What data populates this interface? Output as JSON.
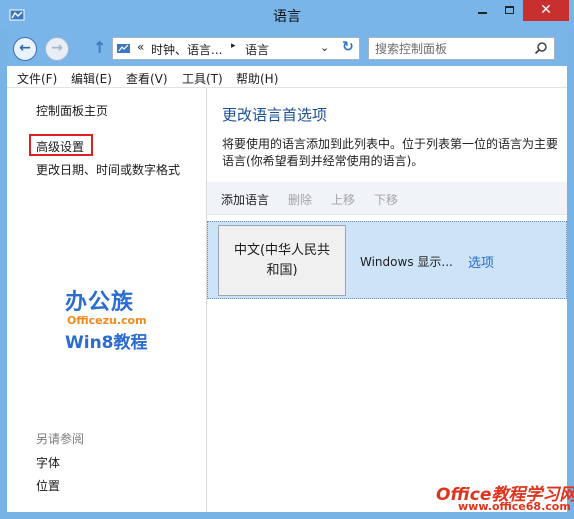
{
  "window": {
    "title": "语言",
    "minimize_icon": "minimize-icon",
    "maximize_icon": "maximize-icon",
    "close_glyph": "✕"
  },
  "nav": {
    "back_glyph": "←",
    "forward_glyph": "→",
    "up_glyph": "↑",
    "breadcrumb_prefix": "«",
    "crumbs": [
      "时钟、语言...",
      "语言"
    ],
    "crumb_separator": "▸",
    "dropdown_glyph": "⌄",
    "refresh_glyph": "↻",
    "search_placeholder": "搜索控制面板"
  },
  "menu": {
    "items": [
      "文件(F)",
      "编辑(E)",
      "查看(V)",
      "工具(T)",
      "帮助(H)"
    ]
  },
  "sidebar": {
    "home": "控制面板主页",
    "advanced": "高级设置",
    "datetime": "更改日期、时间或数字格式",
    "see_also_heading": "另请参阅",
    "see_also": [
      "字体",
      "位置"
    ]
  },
  "logo": {
    "line1": "办公族",
    "line2": "Officezu.com",
    "line3": "Win8教程"
  },
  "main": {
    "title": "更改语言首选项",
    "description": "将要使用的语言添加到此列表中。位于列表第一位的语言为主要语言(你希望看到并经常使用的语言)。",
    "toolbar": {
      "add": "添加语言",
      "remove": "删除",
      "up": "上移",
      "down": "下移"
    },
    "languages": [
      {
        "name_line1": "中文(中华人民共",
        "name_line2": "和国)",
        "display": "Windows 显示...",
        "options": "选项"
      }
    ]
  },
  "watermark": {
    "line1": "Office教程学习网",
    "line2": "www.office68.com"
  },
  "colors": {
    "title_bar": "#79b5e8",
    "close_button": "#c7302f",
    "heading": "#1d4f97",
    "link": "#2a6cc4",
    "selection": "#cde3f7",
    "highlight_border": "#e02020"
  }
}
